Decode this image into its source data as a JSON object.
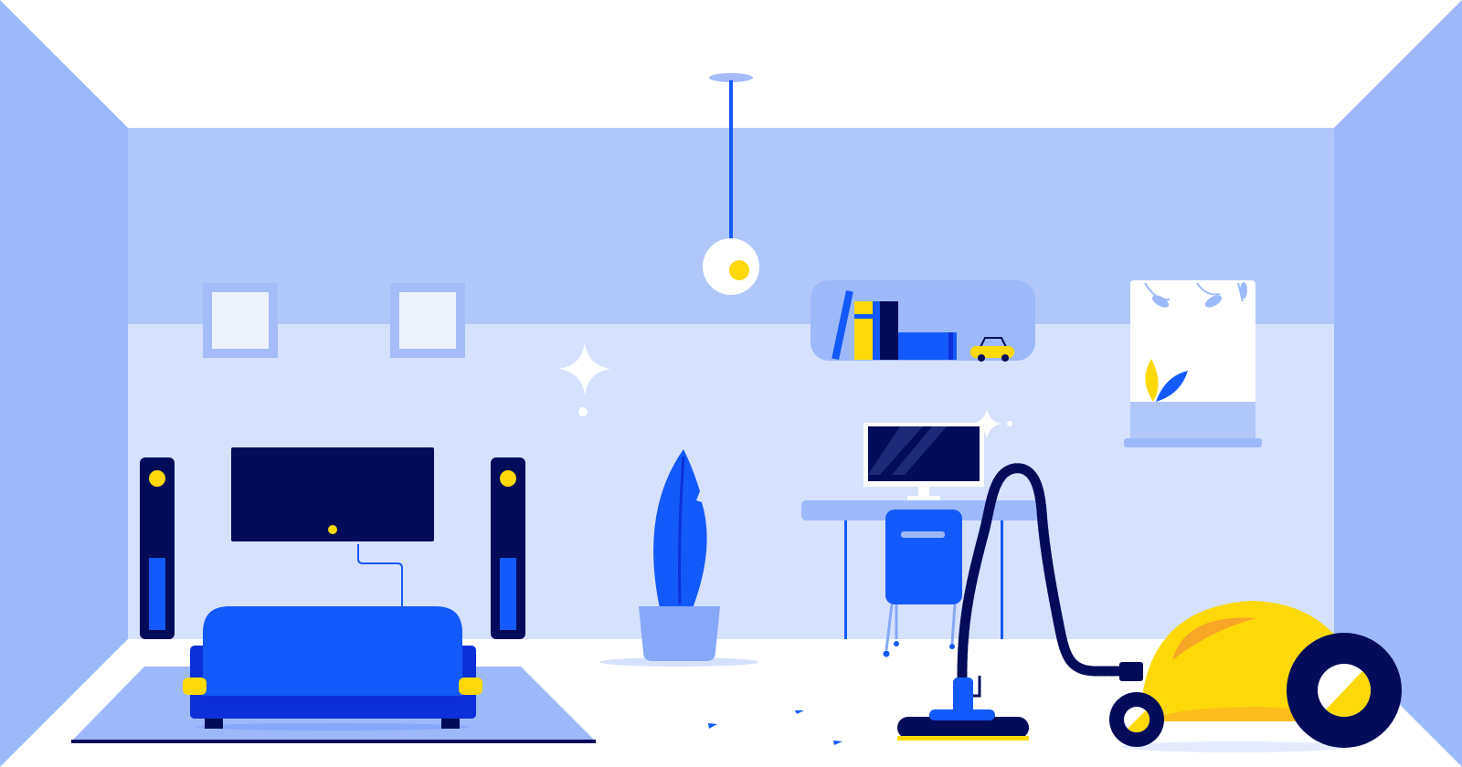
{
  "scene": {
    "subject": "room-cleaning-illustration",
    "palette": {
      "white": "#ffffff",
      "side_wall": "#9cb9fa",
      "upper_wall": "#b1c7fa",
      "lower_wall": "#d6e1fd",
      "floor_shadow": "#e4ebfe",
      "navy": "#040c5a",
      "blue": "#1459fb",
      "blue_dark": "#0d2fd9",
      "light_blue": "#85a8f8",
      "frame_blue": "#a4bdf9",
      "yellow": "#fdd90a",
      "orange": "#f7a626",
      "picture_fill": "#eef2fd"
    },
    "icons": [
      "ceiling-lamp-icon",
      "picture-frame-icon",
      "sparkle-icon",
      "speaker-icon",
      "tv-icon",
      "sofa-icon",
      "rug-icon",
      "plant-icon",
      "bookshelf-icon",
      "toy-car-icon",
      "window-icon",
      "monitor-icon",
      "desk-icon",
      "chair-icon",
      "vacuum-cleaner-icon"
    ]
  }
}
